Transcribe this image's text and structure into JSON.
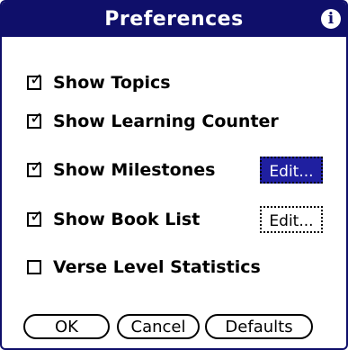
{
  "title": "Preferences",
  "icons": {
    "info": "info-icon"
  },
  "options": [
    {
      "label": "Show Topics",
      "checked": true
    },
    {
      "label": "Show Learning Counter",
      "checked": true
    },
    {
      "label": "Show Milestones",
      "checked": true
    },
    {
      "label": "Show Book List",
      "checked": true
    },
    {
      "label": "Verse Level Statistics",
      "checked": false
    }
  ],
  "edit_buttons": {
    "milestones": "Edit...",
    "book_list": "Edit..."
  },
  "buttons": {
    "ok": "OK",
    "cancel": "Cancel",
    "defaults": "Defaults"
  },
  "checkmark": "✓",
  "colors": {
    "title_bg": "#0f0f6a",
    "selected_button": "#1f1fa0"
  }
}
